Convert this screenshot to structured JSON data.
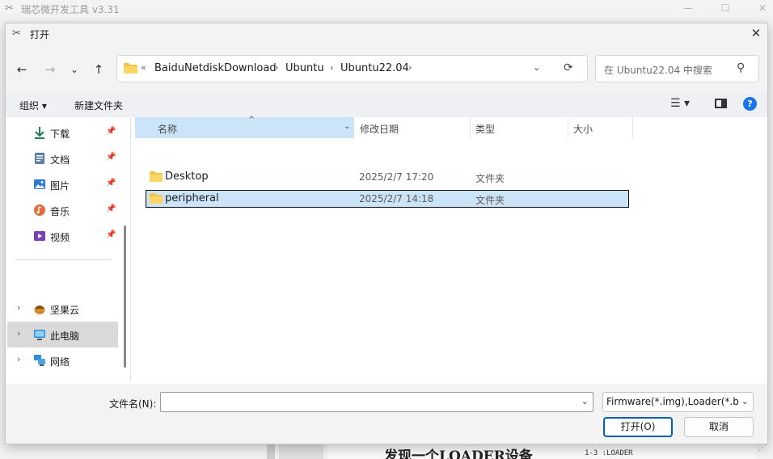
{
  "background_app": {
    "title": "瑞芯微开发工具 v3.31",
    "doc_heading": "发现一个LOADER设备",
    "doc_code": "1-3 :LOADER"
  },
  "dialog": {
    "title": "打开",
    "close_symbol": "✕",
    "nav": {
      "back": "←",
      "forward": "→",
      "recent": "⌄",
      "up": "↑"
    },
    "address": {
      "chevron": "«",
      "breadcrumbs": [
        "BaiduNetdiskDownload",
        "Ubuntu",
        "Ubuntu22.04"
      ],
      "separator": "›",
      "dropdown": "⌄",
      "refresh": "⟳"
    },
    "search": {
      "placeholder": "在 Ubuntu22.04 中搜索",
      "icon": "⚲"
    },
    "toolbar": {
      "organize": "组织 ▾",
      "new_folder": "新建文件夹",
      "view": "☰ ▾",
      "help": "?"
    },
    "sidebar": {
      "quick_access": [
        {
          "label": "下载",
          "icon": "download-icon"
        },
        {
          "label": "文档",
          "icon": "document-icon"
        },
        {
          "label": "图片",
          "icon": "picture-icon"
        },
        {
          "label": "音乐",
          "icon": "music-icon"
        },
        {
          "label": "视频",
          "icon": "video-icon"
        }
      ],
      "pin_symbol": "📌",
      "tree": [
        {
          "label": "坚果云",
          "icon": "nutstore-icon"
        },
        {
          "label": "此电脑",
          "icon": "computer-icon"
        },
        {
          "label": "网络",
          "icon": "network-icon"
        }
      ],
      "expand_symbol": "›"
    },
    "columns": {
      "name": "名称",
      "date": "修改日期",
      "type": "类型",
      "size": "大小",
      "sort": "^",
      "dropdown": "⌄"
    },
    "files": [
      {
        "name": "Desktop",
        "date": "2025/2/7 17:20",
        "type": "文件夹",
        "selected": false
      },
      {
        "name": "peripheral",
        "date": "2025/2/7 14:18",
        "type": "文件夹",
        "selected": true
      }
    ],
    "bottom": {
      "filename_label": "文件名(N):",
      "filename_value": "",
      "filter": "Firmware(*.img),Loader(*.bin",
      "open": "打开(O)",
      "cancel": "取消"
    }
  },
  "colors": {
    "accent": "#005fb8",
    "selection": "#cce4f7",
    "folder": "#f5c344"
  }
}
